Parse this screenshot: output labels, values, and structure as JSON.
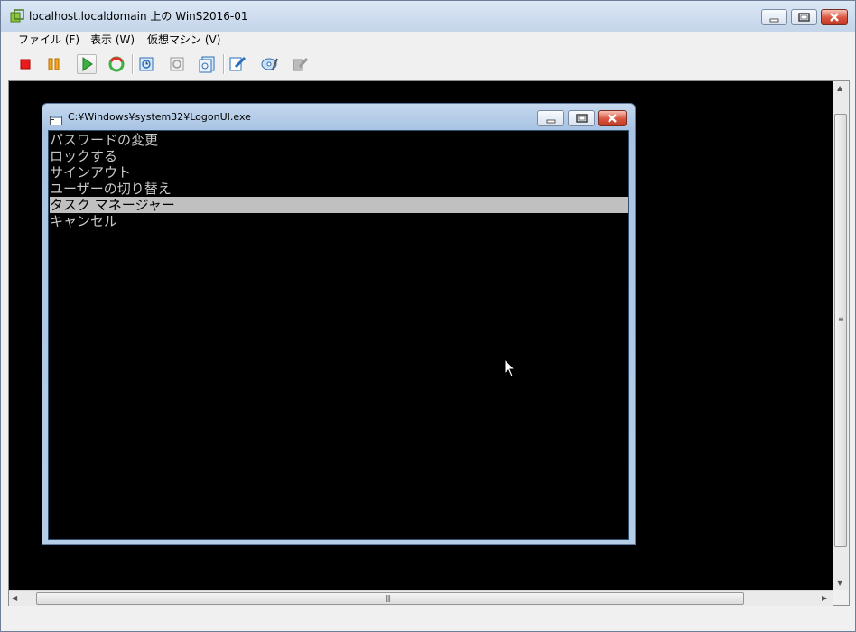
{
  "window": {
    "title": "localhost.localdomain 上の WinS2016-01"
  },
  "menu": [
    {
      "label": "ファイル (F)"
    },
    {
      "label": "表示 (W)"
    },
    {
      "label": "仮想マシン (V)"
    }
  ],
  "toolbar": {
    "buttons": [
      "stop-icon",
      "pause-icon",
      "play-icon",
      "reset-icon",
      "snapshot-icon",
      "revert-snapshot-icon",
      "manage-snapshots-icon",
      "edit-settings-icon",
      "cd-drive-icon",
      "floppy-drive-icon"
    ]
  },
  "console": {
    "dialog_title": "C:¥Windows¥system32¥LogonUI.exe",
    "options": [
      {
        "label": "パスワードの変更",
        "selected": false
      },
      {
        "label": "ロックする",
        "selected": false
      },
      {
        "label": "サインアウト",
        "selected": false
      },
      {
        "label": "ユーザーの切り替え",
        "selected": false
      },
      {
        "label": "タスク マネージャー",
        "selected": true
      },
      {
        "label": "キャンセル",
        "selected": false
      }
    ]
  },
  "colors": {
    "console_bg": "#000000",
    "selected_bg": "#c0c0c0",
    "option_text": "#c8c8c8"
  }
}
